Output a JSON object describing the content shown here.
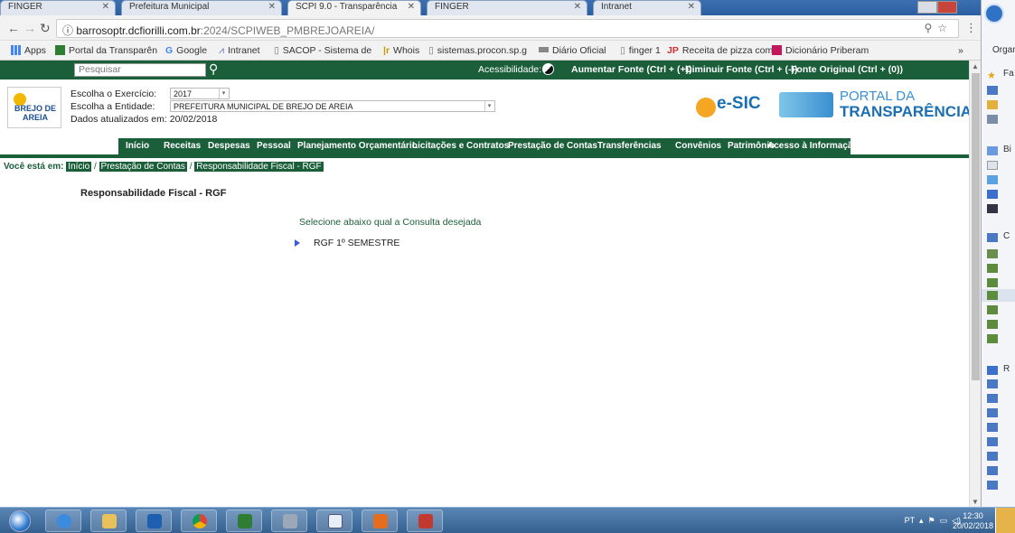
{
  "browser": {
    "tabs": [
      {
        "label": "FINGER"
      },
      {
        "label": "Prefeitura Municipal"
      },
      {
        "label": "SCPI 9.0 - Transparência"
      },
      {
        "label": "FINGER"
      },
      {
        "label": "Intranet"
      }
    ],
    "url_host": "barrosoptr.dcfiorilli.com.br",
    "url_path": ":2024/SCPIWEB_PMBREJOAREIA/",
    "bookmarks": [
      {
        "label": "Apps"
      },
      {
        "label": "Portal da Transparên"
      },
      {
        "label": "Google"
      },
      {
        "label": "Intranet"
      },
      {
        "label": "SACOP - Sistema de"
      },
      {
        "label": "Whois"
      },
      {
        "label": "sistemas.procon.sp.g"
      },
      {
        "label": "Diário Oficial"
      },
      {
        "label": "finger 1"
      },
      {
        "label": "Receita de pizza com"
      },
      {
        "label": "Dicionário Priberam"
      }
    ],
    "more_bookmarks": "»"
  },
  "topbar": {
    "search_placeholder": "Pesquisar",
    "acessibilidade": "Acessibilidade:",
    "aumentar": "Aumentar Fonte (Ctrl + (+))",
    "diminuir": "Diminuir Fonte (Ctrl + (-))",
    "original": "Fonte Original (Ctrl + (0))"
  },
  "header": {
    "logo_text": "BREJO DE AREIA",
    "exercicio_label": "Escolha o Exercício:",
    "exercicio_value": "2017",
    "entidade_label": "Escolha a Entidade:",
    "entidade_value": "PREFEITURA MUNICIPAL DE BREJO DE AREIA",
    "dados_atualizados": "Dados atualizados em: 20/02/2018",
    "esic_label": "e-SIC",
    "portal_line1": "PORTAL DA",
    "portal_line2": "TRANSPARÊNCIA"
  },
  "menu": [
    {
      "label": "Início"
    },
    {
      "label": "Receitas"
    },
    {
      "label": "Despesas"
    },
    {
      "label": "Pessoal"
    },
    {
      "label": "Planejamento Orçamentário"
    },
    {
      "label": "Licitações e Contratos"
    },
    {
      "label": "Prestação de Contas"
    },
    {
      "label": "Transferências"
    },
    {
      "label": "Convênios"
    },
    {
      "label": "Patrimônio"
    },
    {
      "label": "Acesso à Informação"
    }
  ],
  "breadcrumb": {
    "label": "Você está em:",
    "items": [
      "Início",
      "Prestação de Contas",
      "Responsabilidade Fiscal - RGF"
    ],
    "separator": "/"
  },
  "content": {
    "title": "Responsabilidade Fiscal - RGF",
    "prompt": "Selecione abaixo qual a Consulta desejada",
    "item": "RGF 1º SEMESTRE"
  },
  "sidebar": {
    "organ": "Organ",
    "fav": "Fa",
    "bi": "Bi",
    "c": "C",
    "r": "R"
  },
  "taskbar": {
    "lang": "PT",
    "time": "12:30",
    "date": "20/02/2018"
  },
  "colors": {
    "brand_green": "#1b5e3a",
    "link_blue": "#1a6fb3"
  }
}
